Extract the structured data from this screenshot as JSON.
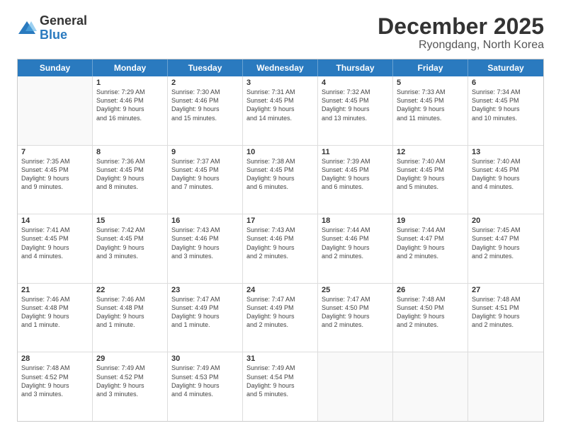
{
  "logo": {
    "general": "General",
    "blue": "Blue"
  },
  "title": "December 2025",
  "subtitle": "Ryongdang, North Korea",
  "header_days": [
    "Sunday",
    "Monday",
    "Tuesday",
    "Wednesday",
    "Thursday",
    "Friday",
    "Saturday"
  ],
  "weeks": [
    [
      {
        "day": "",
        "lines": []
      },
      {
        "day": "1",
        "lines": [
          "Sunrise: 7:29 AM",
          "Sunset: 4:46 PM",
          "Daylight: 9 hours",
          "and 16 minutes."
        ]
      },
      {
        "day": "2",
        "lines": [
          "Sunrise: 7:30 AM",
          "Sunset: 4:46 PM",
          "Daylight: 9 hours",
          "and 15 minutes."
        ]
      },
      {
        "day": "3",
        "lines": [
          "Sunrise: 7:31 AM",
          "Sunset: 4:45 PM",
          "Daylight: 9 hours",
          "and 14 minutes."
        ]
      },
      {
        "day": "4",
        "lines": [
          "Sunrise: 7:32 AM",
          "Sunset: 4:45 PM",
          "Daylight: 9 hours",
          "and 13 minutes."
        ]
      },
      {
        "day": "5",
        "lines": [
          "Sunrise: 7:33 AM",
          "Sunset: 4:45 PM",
          "Daylight: 9 hours",
          "and 11 minutes."
        ]
      },
      {
        "day": "6",
        "lines": [
          "Sunrise: 7:34 AM",
          "Sunset: 4:45 PM",
          "Daylight: 9 hours",
          "and 10 minutes."
        ]
      }
    ],
    [
      {
        "day": "7",
        "lines": [
          "Sunrise: 7:35 AM",
          "Sunset: 4:45 PM",
          "Daylight: 9 hours",
          "and 9 minutes."
        ]
      },
      {
        "day": "8",
        "lines": [
          "Sunrise: 7:36 AM",
          "Sunset: 4:45 PM",
          "Daylight: 9 hours",
          "and 8 minutes."
        ]
      },
      {
        "day": "9",
        "lines": [
          "Sunrise: 7:37 AM",
          "Sunset: 4:45 PM",
          "Daylight: 9 hours",
          "and 7 minutes."
        ]
      },
      {
        "day": "10",
        "lines": [
          "Sunrise: 7:38 AM",
          "Sunset: 4:45 PM",
          "Daylight: 9 hours",
          "and 6 minutes."
        ]
      },
      {
        "day": "11",
        "lines": [
          "Sunrise: 7:39 AM",
          "Sunset: 4:45 PM",
          "Daylight: 9 hours",
          "and 6 minutes."
        ]
      },
      {
        "day": "12",
        "lines": [
          "Sunrise: 7:40 AM",
          "Sunset: 4:45 PM",
          "Daylight: 9 hours",
          "and 5 minutes."
        ]
      },
      {
        "day": "13",
        "lines": [
          "Sunrise: 7:40 AM",
          "Sunset: 4:45 PM",
          "Daylight: 9 hours",
          "and 4 minutes."
        ]
      }
    ],
    [
      {
        "day": "14",
        "lines": [
          "Sunrise: 7:41 AM",
          "Sunset: 4:45 PM",
          "Daylight: 9 hours",
          "and 4 minutes."
        ]
      },
      {
        "day": "15",
        "lines": [
          "Sunrise: 7:42 AM",
          "Sunset: 4:45 PM",
          "Daylight: 9 hours",
          "and 3 minutes."
        ]
      },
      {
        "day": "16",
        "lines": [
          "Sunrise: 7:43 AM",
          "Sunset: 4:46 PM",
          "Daylight: 9 hours",
          "and 3 minutes."
        ]
      },
      {
        "day": "17",
        "lines": [
          "Sunrise: 7:43 AM",
          "Sunset: 4:46 PM",
          "Daylight: 9 hours",
          "and 2 minutes."
        ]
      },
      {
        "day": "18",
        "lines": [
          "Sunrise: 7:44 AM",
          "Sunset: 4:46 PM",
          "Daylight: 9 hours",
          "and 2 minutes."
        ]
      },
      {
        "day": "19",
        "lines": [
          "Sunrise: 7:44 AM",
          "Sunset: 4:47 PM",
          "Daylight: 9 hours",
          "and 2 minutes."
        ]
      },
      {
        "day": "20",
        "lines": [
          "Sunrise: 7:45 AM",
          "Sunset: 4:47 PM",
          "Daylight: 9 hours",
          "and 2 minutes."
        ]
      }
    ],
    [
      {
        "day": "21",
        "lines": [
          "Sunrise: 7:46 AM",
          "Sunset: 4:48 PM",
          "Daylight: 9 hours",
          "and 1 minute."
        ]
      },
      {
        "day": "22",
        "lines": [
          "Sunrise: 7:46 AM",
          "Sunset: 4:48 PM",
          "Daylight: 9 hours",
          "and 1 minute."
        ]
      },
      {
        "day": "23",
        "lines": [
          "Sunrise: 7:47 AM",
          "Sunset: 4:49 PM",
          "Daylight: 9 hours",
          "and 1 minute."
        ]
      },
      {
        "day": "24",
        "lines": [
          "Sunrise: 7:47 AM",
          "Sunset: 4:49 PM",
          "Daylight: 9 hours",
          "and 2 minutes."
        ]
      },
      {
        "day": "25",
        "lines": [
          "Sunrise: 7:47 AM",
          "Sunset: 4:50 PM",
          "Daylight: 9 hours",
          "and 2 minutes."
        ]
      },
      {
        "day": "26",
        "lines": [
          "Sunrise: 7:48 AM",
          "Sunset: 4:50 PM",
          "Daylight: 9 hours",
          "and 2 minutes."
        ]
      },
      {
        "day": "27",
        "lines": [
          "Sunrise: 7:48 AM",
          "Sunset: 4:51 PM",
          "Daylight: 9 hours",
          "and 2 minutes."
        ]
      }
    ],
    [
      {
        "day": "28",
        "lines": [
          "Sunrise: 7:48 AM",
          "Sunset: 4:52 PM",
          "Daylight: 9 hours",
          "and 3 minutes."
        ]
      },
      {
        "day": "29",
        "lines": [
          "Sunrise: 7:49 AM",
          "Sunset: 4:52 PM",
          "Daylight: 9 hours",
          "and 3 minutes."
        ]
      },
      {
        "day": "30",
        "lines": [
          "Sunrise: 7:49 AM",
          "Sunset: 4:53 PM",
          "Daylight: 9 hours",
          "and 4 minutes."
        ]
      },
      {
        "day": "31",
        "lines": [
          "Sunrise: 7:49 AM",
          "Sunset: 4:54 PM",
          "Daylight: 9 hours",
          "and 5 minutes."
        ]
      },
      {
        "day": "",
        "lines": []
      },
      {
        "day": "",
        "lines": []
      },
      {
        "day": "",
        "lines": []
      }
    ]
  ]
}
